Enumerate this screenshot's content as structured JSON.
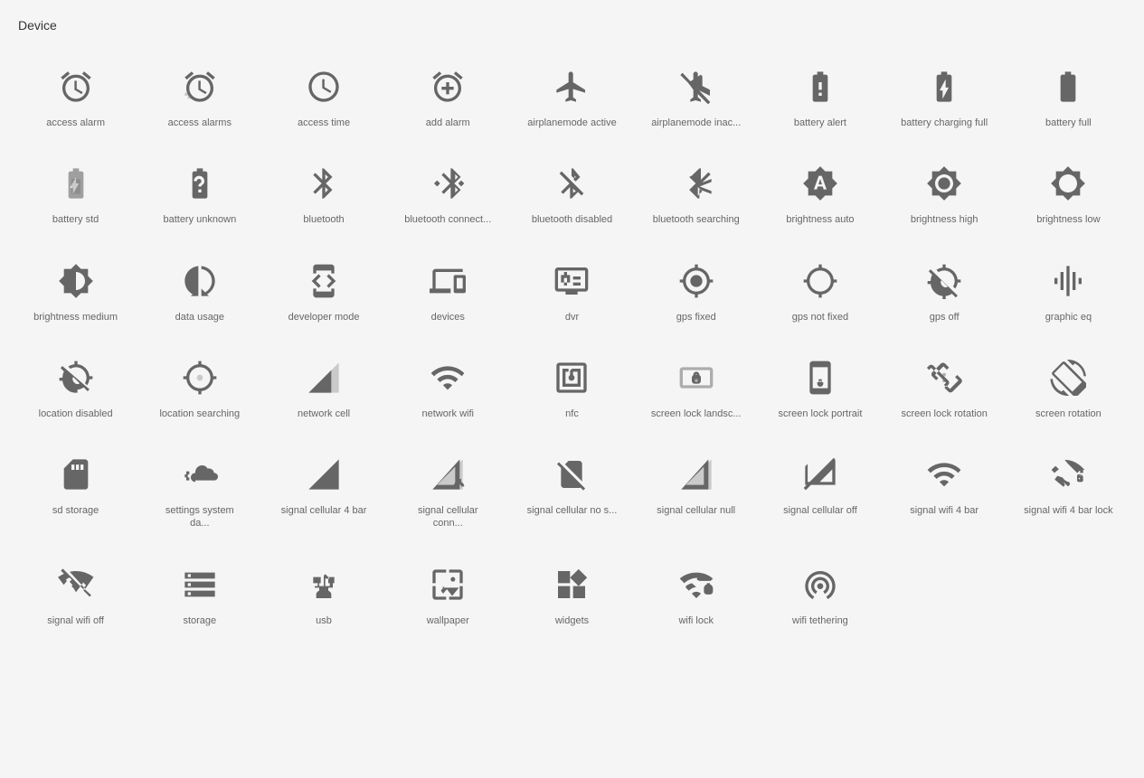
{
  "section": {
    "title": "Device"
  },
  "icons": [
    {
      "id": "access-alarm",
      "label": "access alarm"
    },
    {
      "id": "access-alarms",
      "label": "access alarms"
    },
    {
      "id": "access-time",
      "label": "access time"
    },
    {
      "id": "add-alarm",
      "label": "add alarm"
    },
    {
      "id": "airplanemode-active",
      "label": "airplanemode active"
    },
    {
      "id": "airplanemode-inactive",
      "label": "airplanemode inac..."
    },
    {
      "id": "battery-alert",
      "label": "battery alert"
    },
    {
      "id": "battery-charging-full",
      "label": "battery charging full"
    },
    {
      "id": "battery-full",
      "label": "battery full"
    },
    {
      "id": "battery-std",
      "label": "battery std"
    },
    {
      "id": "battery-unknown",
      "label": "battery unknown"
    },
    {
      "id": "bluetooth",
      "label": "bluetooth"
    },
    {
      "id": "bluetooth-connected",
      "label": "bluetooth connect..."
    },
    {
      "id": "bluetooth-disabled",
      "label": "bluetooth disabled"
    },
    {
      "id": "bluetooth-searching",
      "label": "bluetooth searching"
    },
    {
      "id": "brightness-auto",
      "label": "brightness auto"
    },
    {
      "id": "brightness-high",
      "label": "brightness high"
    },
    {
      "id": "brightness-low",
      "label": "brightness low"
    },
    {
      "id": "brightness-medium",
      "label": "brightness medium"
    },
    {
      "id": "data-usage",
      "label": "data usage"
    },
    {
      "id": "developer-mode",
      "label": "developer mode"
    },
    {
      "id": "devices",
      "label": "devices"
    },
    {
      "id": "dvr",
      "label": "dvr"
    },
    {
      "id": "gps-fixed",
      "label": "gps fixed"
    },
    {
      "id": "gps-not-fixed",
      "label": "gps not fixed"
    },
    {
      "id": "gps-off",
      "label": "gps off"
    },
    {
      "id": "graphic-eq",
      "label": "graphic eq"
    },
    {
      "id": "location-disabled",
      "label": "location disabled"
    },
    {
      "id": "location-searching",
      "label": "location searching"
    },
    {
      "id": "network-cell",
      "label": "network cell"
    },
    {
      "id": "network-wifi",
      "label": "network wifi"
    },
    {
      "id": "nfc",
      "label": "nfc"
    },
    {
      "id": "screen-lock-landscape",
      "label": "screen lock landsc..."
    },
    {
      "id": "screen-lock-portrait",
      "label": "screen lock portrait"
    },
    {
      "id": "screen-lock-rotation",
      "label": "screen lock rotation"
    },
    {
      "id": "screen-rotation",
      "label": "screen rotation"
    },
    {
      "id": "sd-storage",
      "label": "sd storage"
    },
    {
      "id": "settings-system-daydream",
      "label": "settings system da..."
    },
    {
      "id": "signal-cellular-4-bar",
      "label": "signal cellular 4 bar"
    },
    {
      "id": "signal-cellular-connected",
      "label": "signal cellular conn..."
    },
    {
      "id": "signal-cellular-no-sim",
      "label": "signal cellular no s..."
    },
    {
      "id": "signal-cellular-null",
      "label": "signal cellular null"
    },
    {
      "id": "signal-cellular-off",
      "label": "signal cellular off"
    },
    {
      "id": "signal-wifi-4-bar",
      "label": "signal wifi 4 bar"
    },
    {
      "id": "signal-wifi-4-bar-lock",
      "label": "signal wifi 4 bar lock"
    },
    {
      "id": "signal-wifi-off",
      "label": "signal wifi off"
    },
    {
      "id": "storage",
      "label": "storage"
    },
    {
      "id": "usb",
      "label": "usb"
    },
    {
      "id": "wallpaper",
      "label": "wallpaper"
    },
    {
      "id": "widgets",
      "label": "widgets"
    },
    {
      "id": "wifi-lock",
      "label": "wifi lock"
    },
    {
      "id": "wifi-tethering",
      "label": "wifi tethering"
    }
  ]
}
